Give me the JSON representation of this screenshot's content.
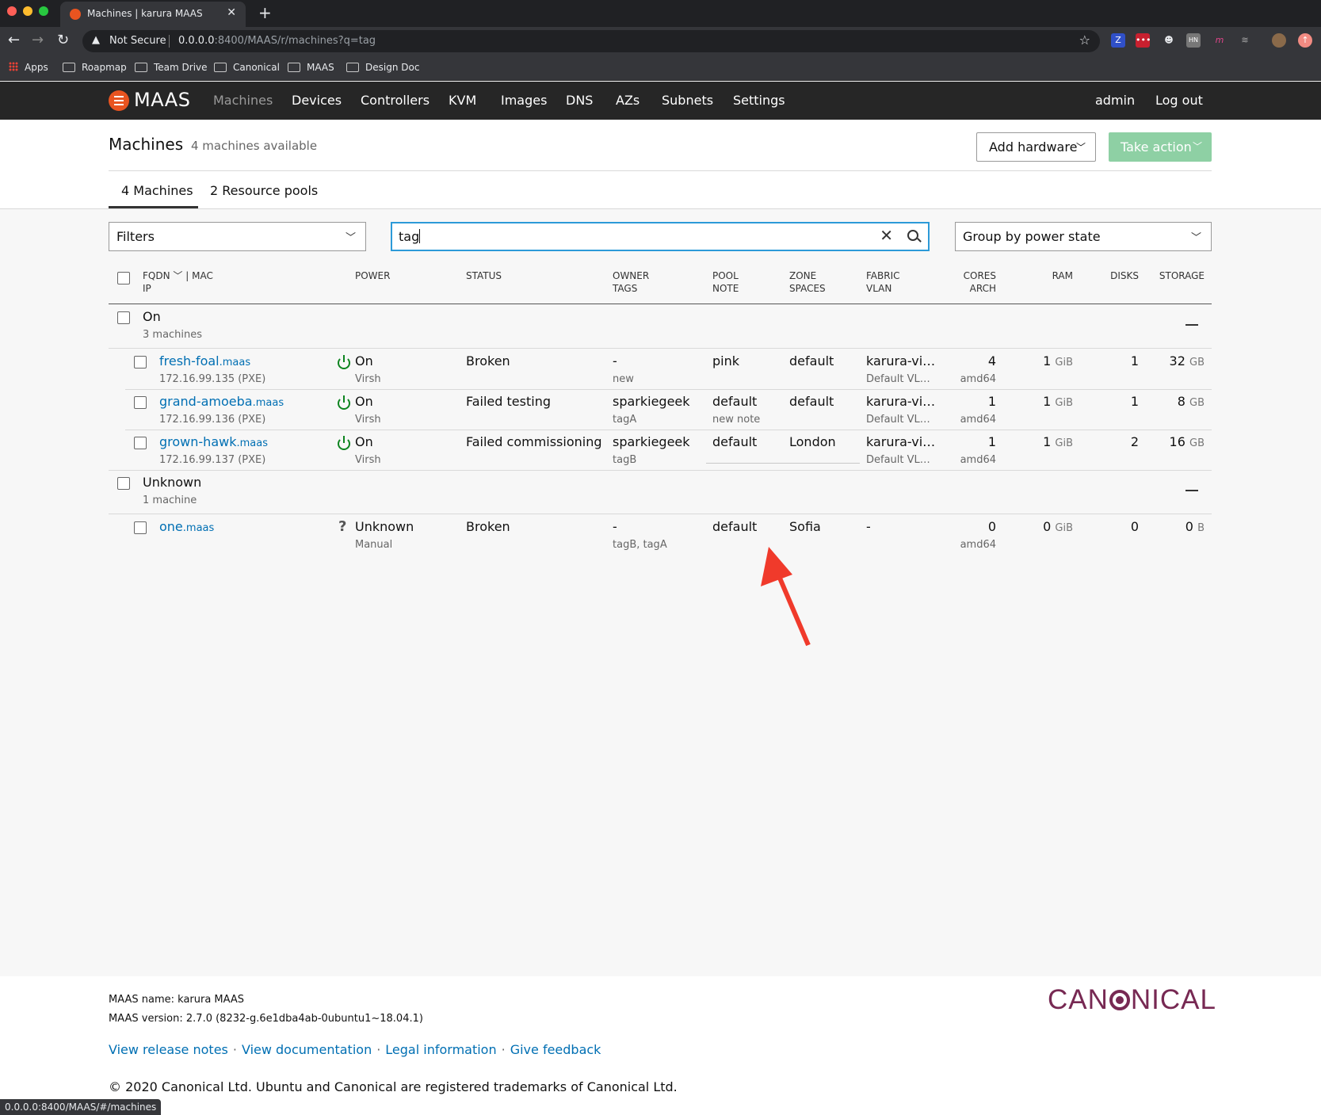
{
  "browser": {
    "tab_title": "Machines | karura MAAS",
    "not_secure": "Not Secure",
    "url_host": "0.0.0.0",
    "url_rest": ":8400/MAAS/r/machines?q=tag",
    "bookmarks": [
      "Apps",
      "Roapmap",
      "Team Drive",
      "Canonical",
      "MAAS",
      "Design Doc"
    ],
    "status_url": "0.0.0.0:8400/MAAS/#/machines"
  },
  "nav": {
    "logo": "MAAS",
    "items": [
      "Machines",
      "Devices",
      "Controllers",
      "KVM",
      "Images",
      "DNS",
      "AZs",
      "Subnets",
      "Settings"
    ],
    "user": "admin",
    "logout": "Log out"
  },
  "header": {
    "title": "Machines",
    "subtitle": "4 machines available",
    "add_hardware": "Add hardware",
    "take_action": "Take action",
    "tabs": [
      "4 Machines",
      "2 Resource pools"
    ]
  },
  "controls": {
    "filters": "Filters",
    "search_value": "tag",
    "group_by": "Group by power state"
  },
  "table": {
    "headers": {
      "fqdn": "FQDN",
      "mac": "| MAC",
      "ip": "IP",
      "power": "POWER",
      "status": "STATUS",
      "owner": "OWNER",
      "tags": "TAGS",
      "pool": "POOL",
      "note": "NOTE",
      "zone": "ZONE",
      "spaces": "SPACES",
      "fabric": "FABRIC",
      "vlan": "VLAN",
      "cores": "CORES",
      "arch": "ARCH",
      "ram": "RAM",
      "disks": "DISKS",
      "storage": "STORAGE"
    },
    "groups": [
      {
        "name": "On",
        "count": "3 machines",
        "machines": [
          {
            "host": "fresh-foal",
            "domain": ".maas",
            "ip": "172.16.99.135 (PXE)",
            "power": "On",
            "power_type": "Virsh",
            "status": "Broken",
            "owner": "-",
            "tags": "new",
            "pool": "pink",
            "note": "",
            "zone": "default",
            "fabric": "karura-vi…",
            "vlan": "Default VL…",
            "cores": "4",
            "arch": "amd64",
            "ram": "1",
            "ram_unit": "GiB",
            "disks": "1",
            "storage": "32",
            "storage_unit": "GB"
          },
          {
            "host": "grand-amoeba",
            "domain": ".maas",
            "ip": "172.16.99.136 (PXE)",
            "power": "On",
            "power_type": "Virsh",
            "status": "Failed testing",
            "owner": "sparkiegeek",
            "tags": "tagA",
            "pool": "default",
            "note": "new note",
            "zone": "default",
            "fabric": "karura-vi…",
            "vlan": "Default VL…",
            "cores": "1",
            "arch": "amd64",
            "ram": "1",
            "ram_unit": "GiB",
            "disks": "1",
            "storage": "8",
            "storage_unit": "GB"
          },
          {
            "host": "grown-hawk",
            "domain": ".maas",
            "ip": "172.16.99.137 (PXE)",
            "power": "On",
            "power_type": "Virsh",
            "status": "Failed commissioning",
            "owner": "sparkiegeek",
            "tags": "tagB",
            "pool": "default",
            "note": "",
            "zone": "London",
            "fabric": "karura-vi…",
            "vlan": "Default VL…",
            "cores": "1",
            "arch": "amd64",
            "ram": "1",
            "ram_unit": "GiB",
            "disks": "2",
            "storage": "16",
            "storage_unit": "GB"
          }
        ]
      },
      {
        "name": "Unknown",
        "count": "1 machine",
        "machines": [
          {
            "host": "one",
            "domain": ".maas",
            "ip": "",
            "power": "Unknown",
            "power_type": "Manual",
            "status": "Broken",
            "owner": "-",
            "tags": "tagB, tagA",
            "pool": "default",
            "note": "",
            "zone": "Sofia",
            "fabric": "-",
            "vlan": "",
            "cores": "0",
            "arch": "amd64",
            "ram": "0",
            "ram_unit": "GiB",
            "disks": "0",
            "storage": "0",
            "storage_unit": "B"
          }
        ]
      }
    ]
  },
  "footer": {
    "name_label": "MAAS name:",
    "name_value": "karura MAAS",
    "version_label": "MAAS version:",
    "version_value": "2.7.0 (8232-g.6e1dba4ab-0ubuntu1~18.04.1)",
    "links": [
      "View release notes",
      "View documentation",
      "Legal information",
      "Give feedback"
    ],
    "copyright": "© 2020 Canonical Ltd. Ubuntu and Canonical are registered trademarks of Canonical Ltd.",
    "brand_left": "CAN",
    "brand_right": "NICAL"
  },
  "colors": {
    "accent_orange": "#e95420",
    "link_blue": "#006fb3",
    "power_green": "#0e8420",
    "canonical_aubergine": "#772953",
    "focus_blue": "#2c9ad8"
  }
}
